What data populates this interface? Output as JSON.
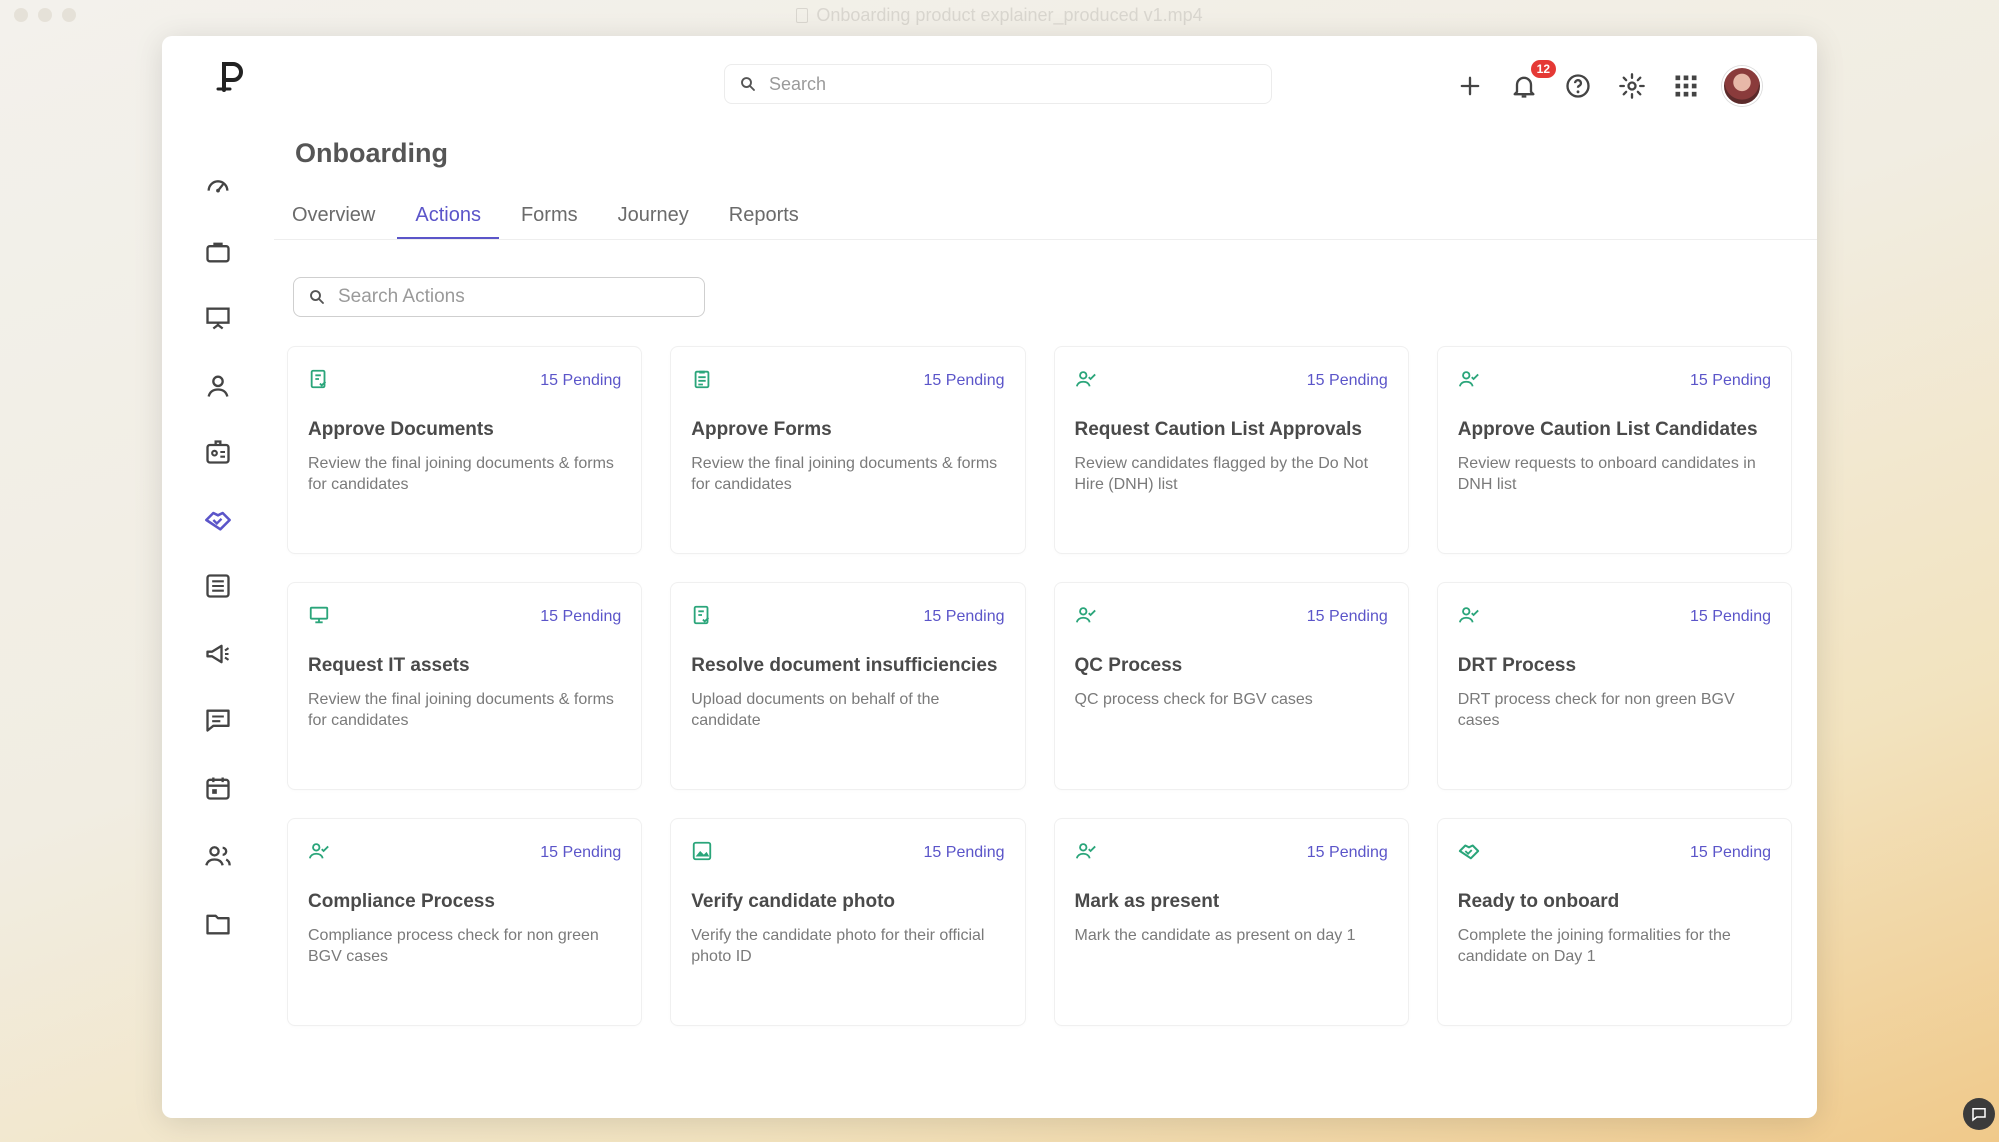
{
  "window": {
    "title": "Onboarding product explainer_produced v1.mp4"
  },
  "header": {
    "search_placeholder": "Search",
    "notification_count": "12"
  },
  "page": {
    "title": "Onboarding"
  },
  "tabs": [
    {
      "label": "Overview"
    },
    {
      "label": "Actions"
    },
    {
      "label": "Forms"
    },
    {
      "label": "Journey"
    },
    {
      "label": "Reports"
    }
  ],
  "actions_search": {
    "placeholder": "Search Actions"
  },
  "sidebar": {
    "items": [
      {
        "icon": "dashboard-icon"
      },
      {
        "icon": "briefcase-icon"
      },
      {
        "icon": "presentation-icon"
      },
      {
        "icon": "user-icon"
      },
      {
        "icon": "id-badge-icon"
      },
      {
        "icon": "handshake-icon"
      },
      {
        "icon": "list-icon"
      },
      {
        "icon": "megaphone-icon"
      },
      {
        "icon": "message-icon"
      },
      {
        "icon": "calendar-icon"
      },
      {
        "icon": "people-icon"
      },
      {
        "icon": "folder-icon"
      }
    ]
  },
  "colors": {
    "accent": "#5b55c9",
    "icon_green": "#2aa57a",
    "badge": "#e53935"
  },
  "cards": [
    {
      "icon": "document-check-icon",
      "pending": "15 Pending",
      "title": "Approve Documents",
      "desc": "Review the final joining documents & forms for candidates"
    },
    {
      "icon": "clipboard-icon",
      "pending": "15 Pending",
      "title": "Approve Forms",
      "desc": "Review the final joining documents & forms for candidates"
    },
    {
      "icon": "user-check-icon",
      "pending": "15 Pending",
      "title": "Request Caution List Approvals",
      "desc": "Review candidates flagged by the Do Not Hire (DNH) list"
    },
    {
      "icon": "user-check-icon",
      "pending": "15 Pending",
      "title": "Approve Caution List Candidates",
      "desc": "Review requests to onboard candidates in DNH list"
    },
    {
      "icon": "monitor-icon",
      "pending": "15 Pending",
      "title": "Request IT assets",
      "desc": "Review the final joining documents & forms for candidates"
    },
    {
      "icon": "document-check-icon",
      "pending": "15 Pending",
      "title": "Resolve document insufficiencies",
      "desc": "Upload documents on behalf of the candidate"
    },
    {
      "icon": "user-check-icon",
      "pending": "15 Pending",
      "title": "QC Process",
      "desc": "QC process check for BGV cases"
    },
    {
      "icon": "user-check-icon",
      "pending": "15 Pending",
      "title": "DRT Process",
      "desc": "DRT process check for non green BGV cases"
    },
    {
      "icon": "user-check-icon",
      "pending": "15 Pending",
      "title": "Compliance Process",
      "desc": "Compliance process check for non green BGV cases"
    },
    {
      "icon": "image-icon",
      "pending": "15 Pending",
      "title": "Verify candidate photo",
      "desc": "Verify the candidate photo for their official photo ID"
    },
    {
      "icon": "user-check-icon",
      "pending": "15 Pending",
      "title": "Mark as present",
      "desc": "Mark the candidate as present on day 1"
    },
    {
      "icon": "handshake-icon",
      "pending": "15 Pending",
      "title": "Ready to onboard",
      "desc": "Complete the joining formalities for the candidate on Day 1"
    }
  ]
}
